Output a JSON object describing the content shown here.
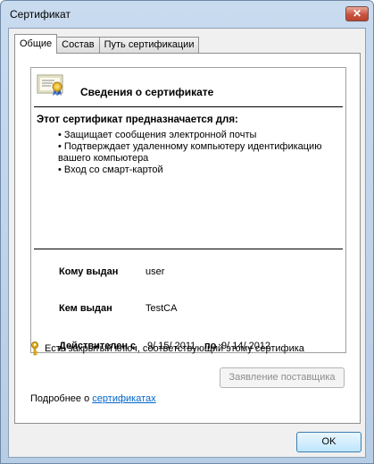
{
  "window": {
    "title": "Сертификат",
    "close_label": "✕"
  },
  "tabs": [
    {
      "label": "Общие",
      "active": true
    },
    {
      "label": "Состав",
      "active": false
    },
    {
      "label": "Путь сертификации",
      "active": false
    }
  ],
  "info": {
    "title": "Сведения о сертификате",
    "purpose_heading": "Этот сертификат предназначается для:",
    "purposes": [
      "• Защищает сообщения электронной почты",
      "• Подтверждает удаленному компьютеру идентификацию",
      "вашего компьютера",
      "• Вход со смарт-картой"
    ],
    "issued_to_label": "Кому выдан",
    "issued_to_value": "user",
    "issued_by_label": "Кем выдан",
    "issued_by_value": "TestCA",
    "valid_label": "Действителен с",
    "valid_from": "9/ 15/ 2011",
    "valid_to_label": "по",
    "valid_to": "9/ 14/ 2012",
    "private_key_text": "Есть закрытый ключ, соответствующий этому сертифика"
  },
  "buttons": {
    "issuer_statement": "Заявление поставщика",
    "ok": "OK"
  },
  "learn_more": {
    "prefix": "Подробнее о ",
    "link": "сертификатах"
  },
  "icons": {
    "certificate": "certificate-icon",
    "key": "key-icon"
  }
}
